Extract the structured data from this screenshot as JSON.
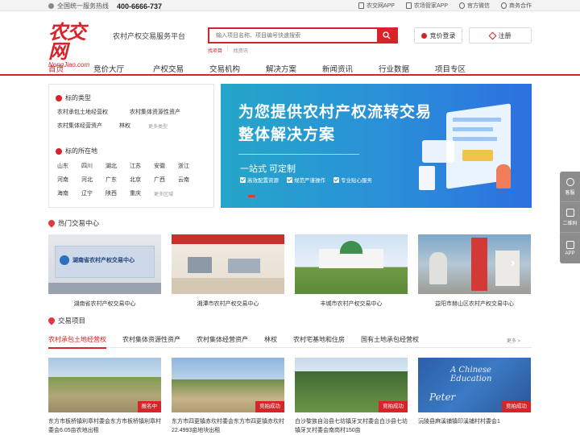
{
  "topbar": {
    "hotline_label": "全国统一服务热线",
    "hotline_number": "400-6666-737",
    "links": [
      "农交网APP",
      "农场管家APP",
      "官方微信",
      "商务合作"
    ]
  },
  "header": {
    "logo_text": "农交网",
    "logo_url_text": "NongJiao.com",
    "slogan": "农村产权交易服务平台",
    "search_placeholder": "输入项目名称、项目编号快速搜索",
    "hot_links": [
      "找项目",
      "找资讯"
    ],
    "login_label": "竞价登录",
    "register_label": "注册"
  },
  "nav": {
    "items": [
      "首页",
      "竞价大厅",
      "产权交易",
      "交易机构",
      "解决方案",
      "新闻资讯",
      "行业数据",
      "项目专区"
    ]
  },
  "filter": {
    "type_title": "标的类型",
    "types": [
      "农村承包土地经营权",
      "农村集体资源性资产",
      "农村集体经营资产",
      "林权"
    ],
    "types_more": "更多类型",
    "region_title": "标的所在地",
    "regions": [
      "山东",
      "四川",
      "湖北",
      "江苏",
      "安徽",
      "浙江",
      "河南",
      "河北",
      "广东",
      "北京",
      "广西",
      "云南",
      "海南",
      "辽宁",
      "陕西",
      "重庆"
    ],
    "regions_more": "更多区域"
  },
  "banner": {
    "line1": "为您提供农村产权流转交易",
    "line2": "整体解决方案",
    "line3": "一站式  可定制",
    "features": [
      "高效配置资源",
      "规范严谨操作",
      "专业贴心服务"
    ]
  },
  "centers": {
    "title": "热门交易中心",
    "items": [
      "湖南省农村产权交易中心",
      "湘潭市农村产权交易中心",
      "丰城市农村产权交易中心",
      "益阳市赫山区农村产权交易中心"
    ],
    "sign_text": "湖南省农村产权交易中心"
  },
  "projects": {
    "title": "交易项目",
    "tabs": [
      "农村承包土地经营权",
      "农村集体资源性资产",
      "农村集体经营资产",
      "林权",
      "农村宅基地和住房",
      "国有土地承包经营权"
    ],
    "more": "更多 >",
    "items": [
      {
        "badge": "报名中",
        "desc": "东方市板桥镇利章村委会东方市板桥镇利章村委会6.05亩农地出租"
      },
      {
        "badge": "竞拍成功",
        "desc": "东方市四更镇赤坎村委会东方市四更镇赤坎村22.4993亩地块出租"
      },
      {
        "badge": "竞拍成功",
        "desc": "白沙黎族自治县七坊镇牙叉村委会白沙县七坊镇牙叉村委会南岗村150亩"
      },
      {
        "badge": "竞拍成功",
        "desc": "沅陵县麻溪铺镇印溪铺村村委会1"
      }
    ]
  },
  "side_tools": [
    "客服",
    "二维码",
    "APP"
  ],
  "colors": {
    "brand_red": "#d8232a",
    "banner_blue": "#2a8fd8"
  }
}
